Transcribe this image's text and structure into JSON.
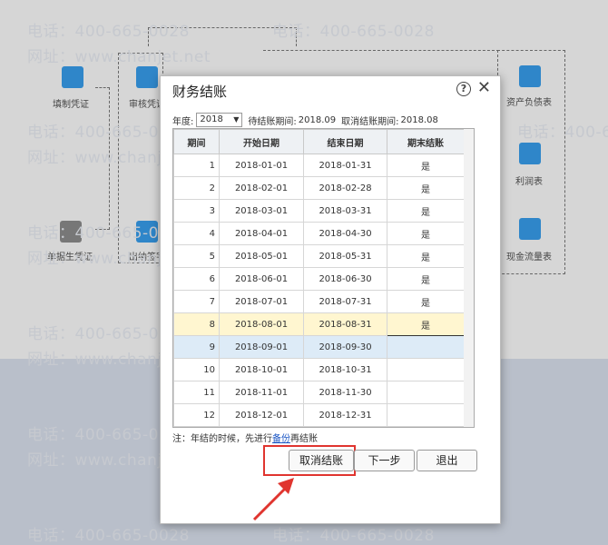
{
  "watermark": {
    "phone": "电话：400-665-0028",
    "web": "网址：www.chanjet.net"
  },
  "flow": {
    "items": [
      {
        "label": "填制凭证",
        "icon": "voucher-entry-icon"
      },
      {
        "label": "审核凭证",
        "icon": "voucher-audit-icon"
      },
      {
        "label": "单据生凭证",
        "icon": "bill-to-voucher-icon"
      },
      {
        "label": "出纳签字",
        "icon": "cashier-sign-icon"
      },
      {
        "label": "资产负债表",
        "icon": "balance-sheet-icon"
      },
      {
        "label": "利润表",
        "icon": "income-statement-icon"
      },
      {
        "label": "现金流量表",
        "icon": "cash-flow-icon"
      }
    ]
  },
  "dialog": {
    "title": "财务结账",
    "help_symbol": "?",
    "close_symbol": "✕",
    "year_label": "年度:",
    "year_value": "2018",
    "current_period_label": "待结账期间:",
    "current_period": "2018.09",
    "cancel_period_label": "取消结账期间:",
    "cancel_period": "2018.08",
    "columns": [
      "期间",
      "开始日期",
      "结束日期",
      "期末结账"
    ],
    "rows": [
      {
        "period": "1",
        "start": "2018-01-01",
        "end": "2018-01-31",
        "closed": "是"
      },
      {
        "period": "2",
        "start": "2018-02-01",
        "end": "2018-02-28",
        "closed": "是"
      },
      {
        "period": "3",
        "start": "2018-03-01",
        "end": "2018-03-31",
        "closed": "是"
      },
      {
        "period": "4",
        "start": "2018-04-01",
        "end": "2018-04-30",
        "closed": "是"
      },
      {
        "period": "5",
        "start": "2018-05-01",
        "end": "2018-05-31",
        "closed": "是"
      },
      {
        "period": "6",
        "start": "2018-06-01",
        "end": "2018-06-30",
        "closed": "是"
      },
      {
        "period": "7",
        "start": "2018-07-01",
        "end": "2018-07-31",
        "closed": "是"
      },
      {
        "period": "8",
        "start": "2018-08-01",
        "end": "2018-08-31",
        "closed": "是"
      },
      {
        "period": "9",
        "start": "2018-09-01",
        "end": "2018-09-30",
        "closed": ""
      },
      {
        "period": "10",
        "start": "2018-10-01",
        "end": "2018-10-31",
        "closed": ""
      },
      {
        "period": "11",
        "start": "2018-11-01",
        "end": "2018-11-30",
        "closed": ""
      },
      {
        "period": "12",
        "start": "2018-12-01",
        "end": "2018-12-31",
        "closed": ""
      }
    ],
    "note_prefix": "注：年结的时候，先进行",
    "note_link": "备份",
    "note_suffix": "再结账",
    "buttons": {
      "cancel_close": "取消结账",
      "next": "下一步",
      "exit": "退出"
    }
  },
  "colors": {
    "highlight_yellow": "#fff6d0",
    "highlight_blue": "#ddebf7",
    "annotation_red": "#e0352f",
    "icon_blue": "#2f86c9"
  }
}
